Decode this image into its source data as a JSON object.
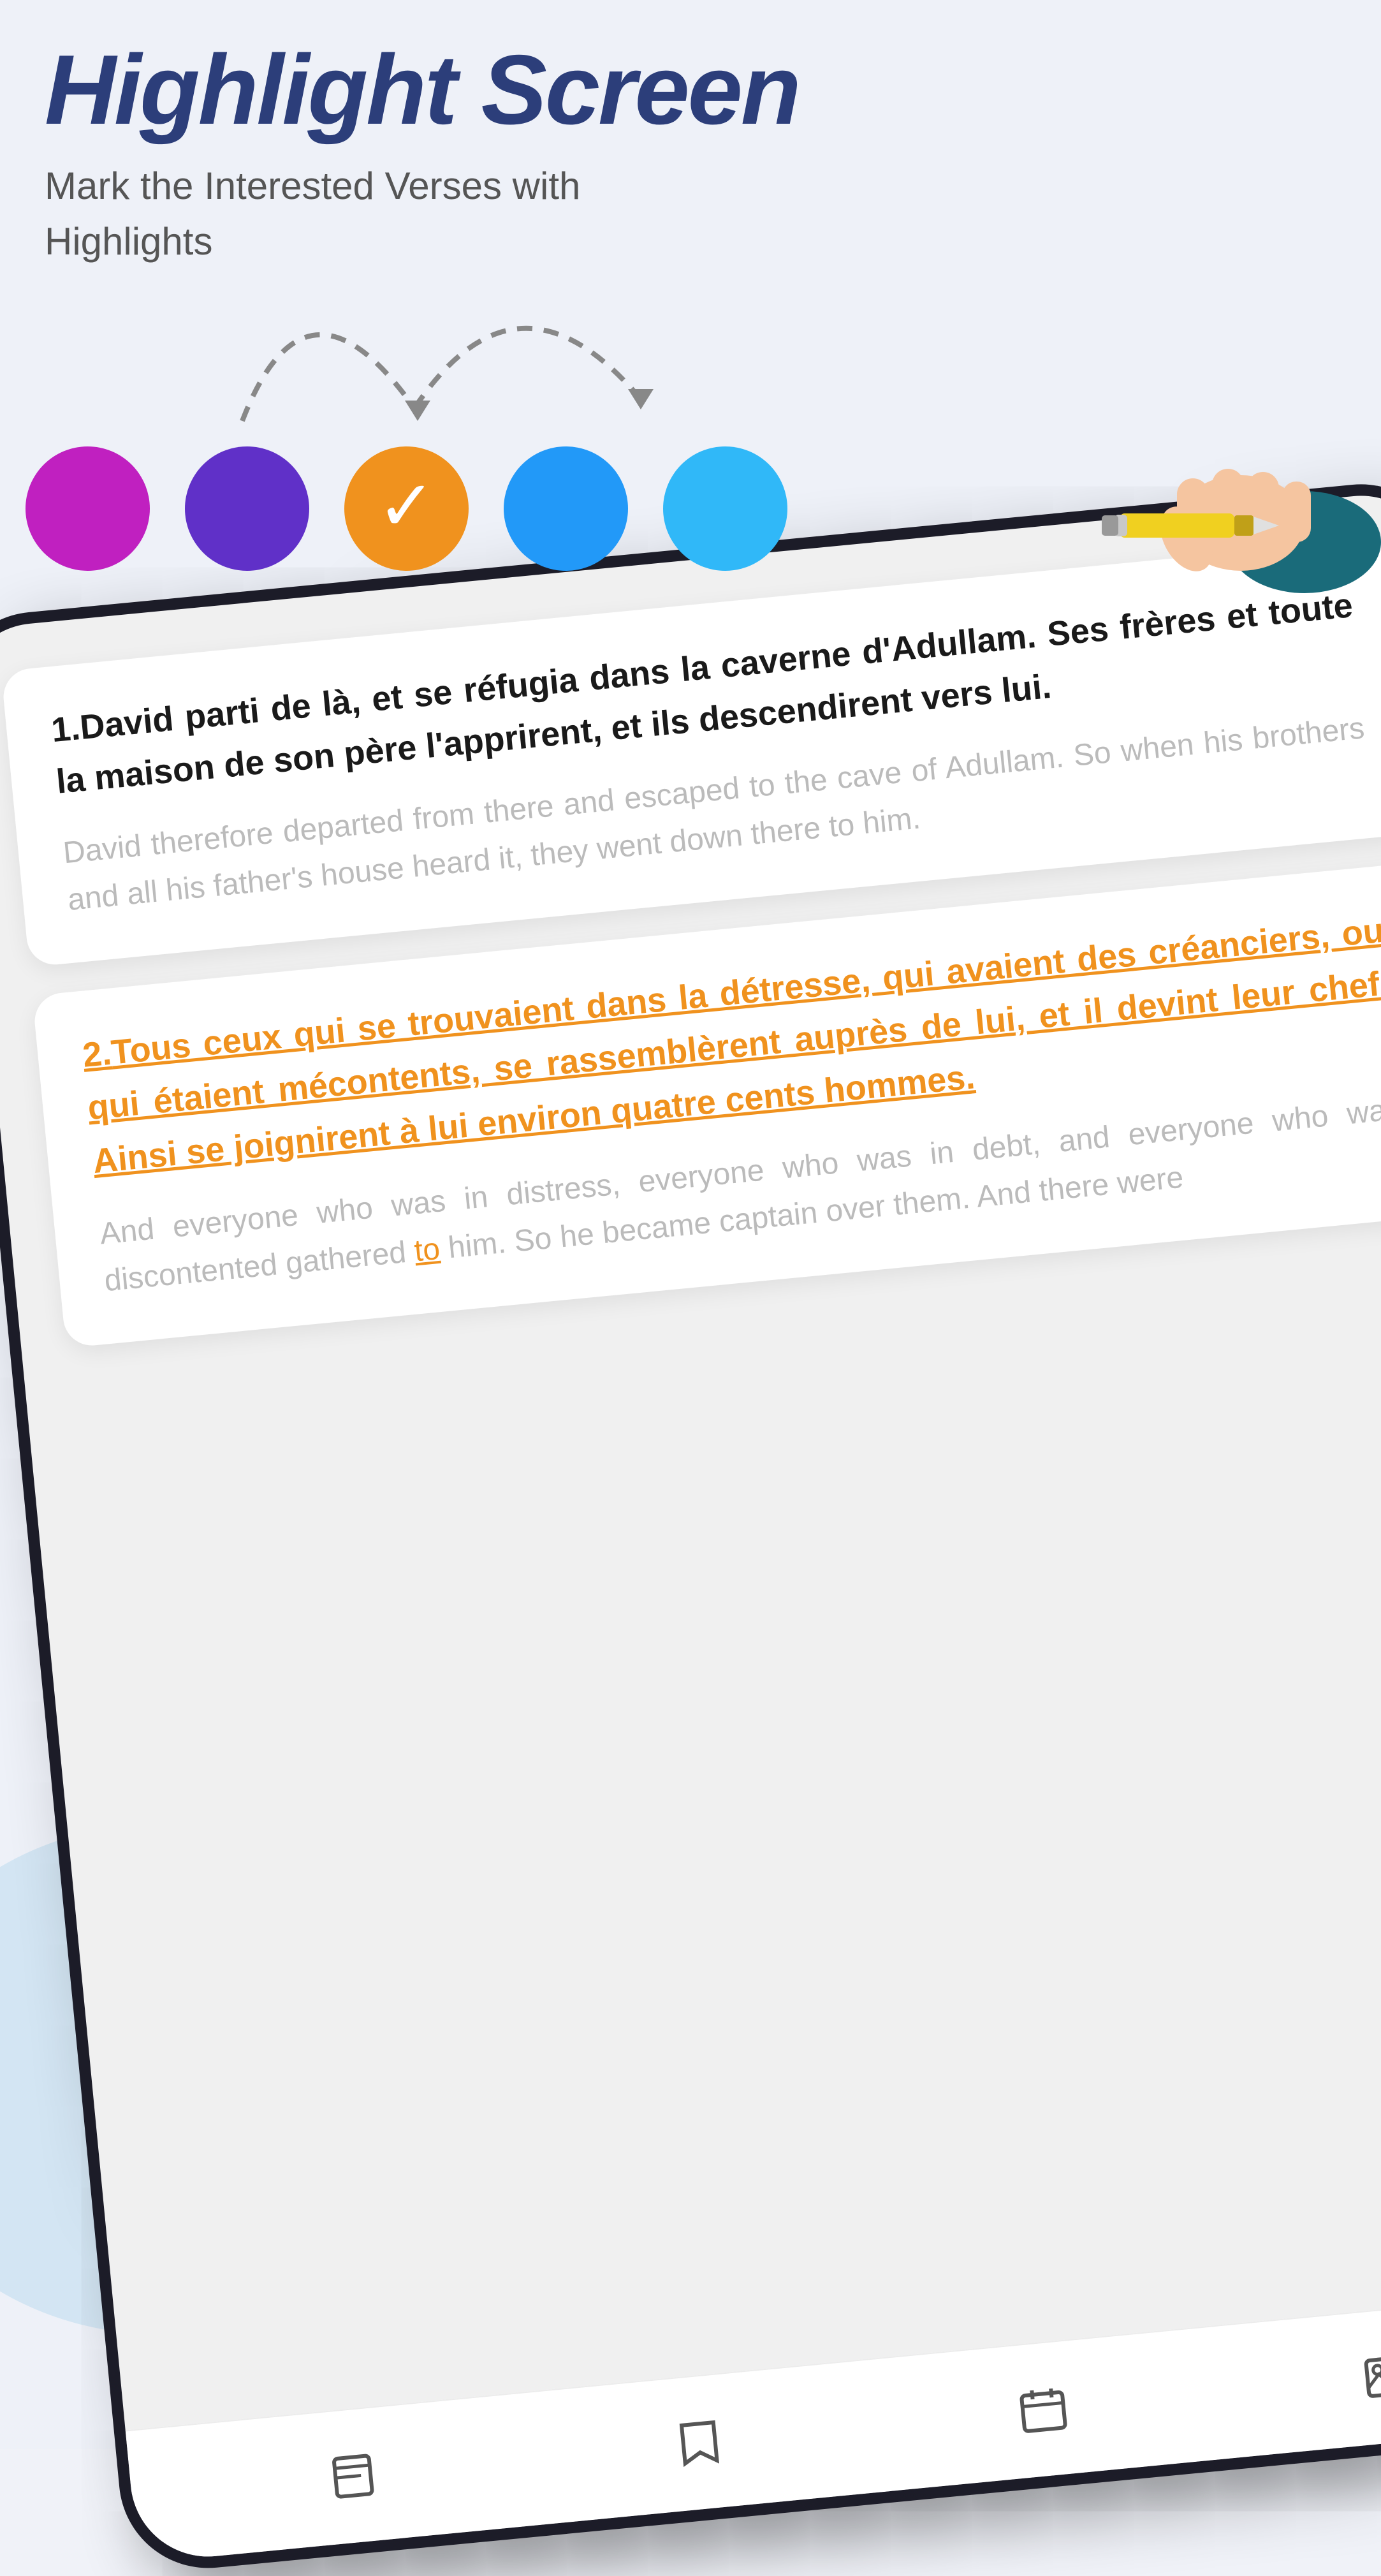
{
  "header": {
    "title": "Highlight Screen",
    "subtitle_line1": "Mark the Interested Verses with",
    "subtitle_line2": "Highlights"
  },
  "colors": {
    "background": "#eef1f8",
    "title": "#2c3e7a",
    "subtitle": "#555555",
    "magenta": "#c020c0",
    "purple": "#6030c8",
    "orange": "#f0921e",
    "blue": "#2299f8",
    "lightblue": "#30b8f8"
  },
  "circles": [
    {
      "id": "magenta",
      "color": "#c020c0",
      "selected": false
    },
    {
      "id": "purple",
      "color": "#6030c8",
      "selected": false
    },
    {
      "id": "orange",
      "color": "#f0921e",
      "selected": true
    },
    {
      "id": "blue",
      "color": "#2299f8",
      "selected": false
    },
    {
      "id": "lightblue",
      "color": "#30b8f8",
      "selected": false
    }
  ],
  "verse1": {
    "number": "1.",
    "french": "David partit de là, et se réfugia dans la caverne d'Adullam. Ses frères et toute la maison de son père l'apprirent, et ils descendirent vers lui.",
    "english": "David therefore departed from there and escaped to the cave of Adullam. So when his brothers and all his father's house heard it, they went down there to him."
  },
  "verse2": {
    "number": "2.",
    "french_highlighted": "Tous ceux qui se trouvaient dans la détresse, qui avaient des créanciers, ou qui étaient mécontents, se rassemblèrent auprès de lui, et il devint leur chef. Ainsi se joignirent à lui environ quatre cents hommes.",
    "english": "And everyone who was in distress, everyone who was in debt, and everyone who was discontented gathered to him. So he became captain over them. And there were"
  },
  "nav_icons": [
    {
      "name": "book-icon",
      "label": "Book"
    },
    {
      "name": "bookmark-icon",
      "label": "Bookmark"
    },
    {
      "name": "calendar-icon",
      "label": "Calendar"
    },
    {
      "name": "image-icon",
      "label": "Image"
    }
  ]
}
